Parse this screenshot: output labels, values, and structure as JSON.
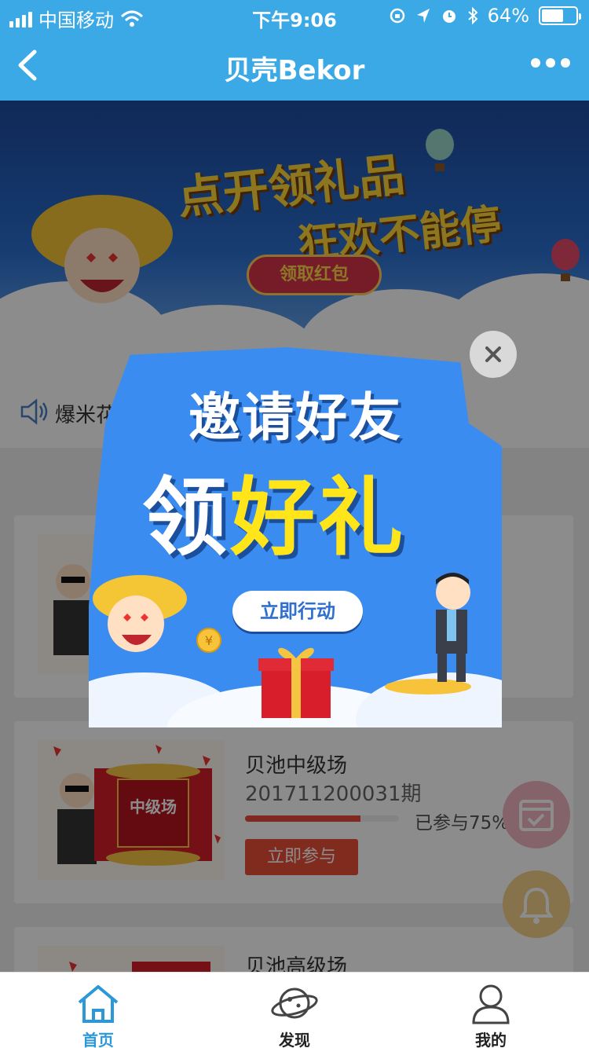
{
  "status_bar": {
    "carrier": "中国移动",
    "time": "下午9:06",
    "battery_percent": "64%",
    "battery_level": 0.64
  },
  "nav": {
    "title": "贝壳Bekor",
    "back_icon": "chevron-left-icon",
    "more_icon": "more-dots-icon"
  },
  "banner": {
    "headline_1": "点开领礼品",
    "headline_2": "狂欢不能停",
    "button": "领取红包"
  },
  "notice": {
    "icon": "speaker-icon",
    "text": "爆米花"
  },
  "cards": [
    {
      "name": "",
      "period": "",
      "progress": 0,
      "percent_text": "",
      "join_label": ""
    },
    {
      "name": "贝池中级场",
      "period": "201711200031期",
      "progress": 0.75,
      "percent_text": "已参与75%",
      "join_label": "立即参与",
      "thumb_label": "中级场"
    },
    {
      "name": "贝池高级场"
    }
  ],
  "popup": {
    "title_line_1": "邀请好友",
    "title_line_2a": "领",
    "title_line_2b": "好礼",
    "action_button": "立即行动",
    "close_icon": "close-icon"
  },
  "fabs": [
    "calendar-check-icon",
    "bell-icon"
  ],
  "tabbar": {
    "tabs": [
      {
        "label": "首页",
        "icon": "home-icon",
        "active": true
      },
      {
        "label": "发现",
        "icon": "planet-icon",
        "active": false
      },
      {
        "label": "我的",
        "icon": "user-icon",
        "active": false
      }
    ]
  },
  "colors": {
    "nav_blue": "#3aa9e6",
    "popup_blue": "#3b8cf0",
    "accent_red": "#ea4f36",
    "active_tab": "#2c98d8",
    "highlight_yellow": "#ffe51a"
  }
}
